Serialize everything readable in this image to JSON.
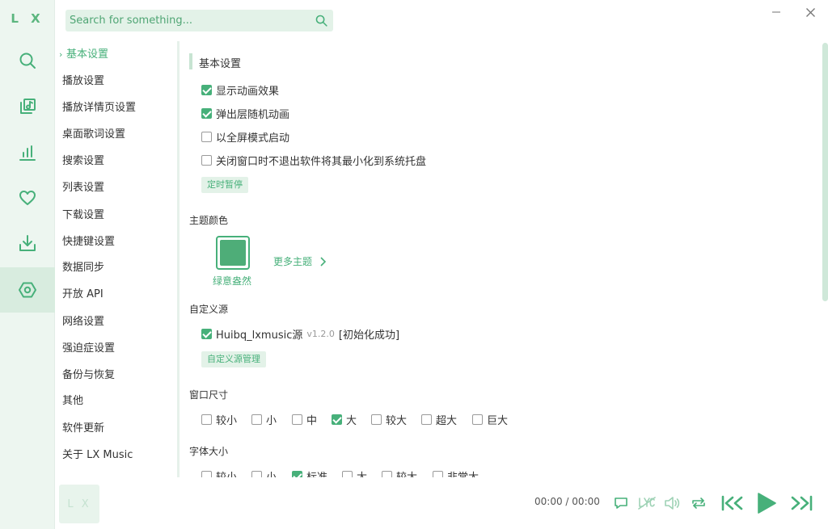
{
  "app": {
    "logo": "L X"
  },
  "search": {
    "placeholder": "Search for something..."
  },
  "nav": {
    "items": [
      {
        "label": "基本设置",
        "active": true
      },
      {
        "label": "播放设置"
      },
      {
        "label": "播放详情页设置"
      },
      {
        "label": "桌面歌词设置"
      },
      {
        "label": "搜索设置"
      },
      {
        "label": "列表设置"
      },
      {
        "label": "下载设置"
      },
      {
        "label": "快捷键设置"
      },
      {
        "label": "数据同步"
      },
      {
        "label": "开放 API"
      },
      {
        "label": "网络设置"
      },
      {
        "label": "强迫症设置"
      },
      {
        "label": "备份与恢复"
      },
      {
        "label": "其他"
      },
      {
        "label": "软件更新"
      },
      {
        "label": "关于 LX Music"
      }
    ]
  },
  "basic": {
    "title": "基本设置",
    "options": [
      {
        "label": "显示动画效果",
        "checked": true
      },
      {
        "label": "弹出层随机动画",
        "checked": true
      },
      {
        "label": "以全屏模式启动",
        "checked": false
      },
      {
        "label": "关闭窗口时不退出软件将其最小化到系统托盘",
        "checked": false
      }
    ],
    "timer_button": "定时暂停"
  },
  "theme": {
    "title": "主题颜色",
    "current_name": "绿意盎然",
    "current_color": "#4ead78",
    "more_label": "更多主题"
  },
  "custom_source": {
    "title": "自定义源",
    "name": "Huibq_lxmusic源",
    "version": "v1.2.0",
    "status": "[初始化成功]",
    "checked": true,
    "manage_button": "自定义源管理"
  },
  "window_size": {
    "title": "窗口尺寸",
    "options": [
      {
        "label": "较小",
        "checked": false
      },
      {
        "label": "小",
        "checked": false
      },
      {
        "label": "中",
        "checked": false
      },
      {
        "label": "大",
        "checked": true
      },
      {
        "label": "较大",
        "checked": false
      },
      {
        "label": "超大",
        "checked": false
      },
      {
        "label": "巨大",
        "checked": false
      }
    ]
  },
  "font_size": {
    "title": "字体大小",
    "options": [
      {
        "label": "较小",
        "checked": false
      },
      {
        "label": "小",
        "checked": false
      },
      {
        "label": "标准",
        "checked": true
      },
      {
        "label": "大",
        "checked": false
      },
      {
        "label": "较大",
        "checked": false
      },
      {
        "label": "非常大",
        "checked": false
      }
    ]
  },
  "player": {
    "cover_text": "L X",
    "current_time": "00:00",
    "separator": "/",
    "total_time": "00:00"
  },
  "colors": {
    "accent": "#47b07a",
    "rail_bg": "#edf6f0",
    "button_bg": "#e3f2e8"
  }
}
